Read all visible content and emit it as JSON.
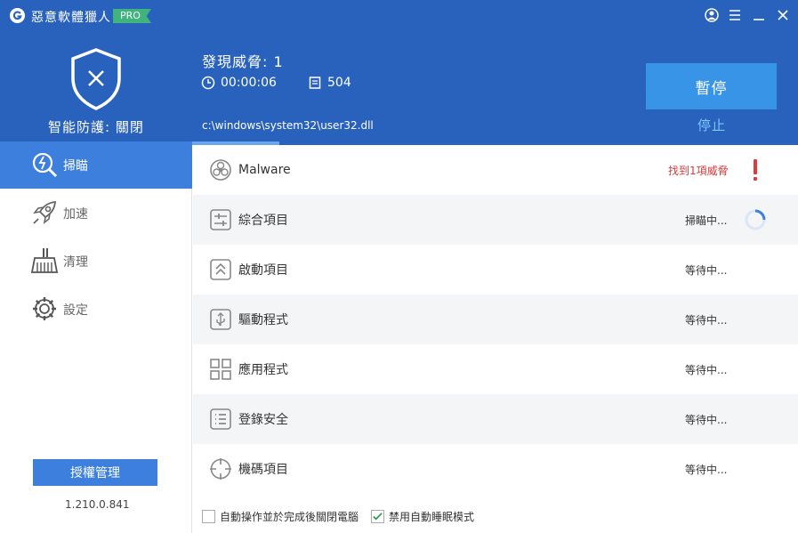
{
  "app": {
    "title": "惡意軟體獵人",
    "badge": "PRO"
  },
  "header": {
    "protect_label": "智能防護: 關閉",
    "threats_text": "發現威脅: 1",
    "elapsed": "00:00:06",
    "scanned_count": "504",
    "current_file": "c:\\windows\\system32\\user32.dll",
    "pause_label": "暫停",
    "stop_label": "停止",
    "progress_fraction": 0.35
  },
  "sidebar": {
    "items": [
      {
        "label": "掃瞄",
        "icon": "scan-icon",
        "active": true
      },
      {
        "label": "加速",
        "icon": "rocket-icon",
        "active": false
      },
      {
        "label": "清理",
        "icon": "broom-icon",
        "active": false
      },
      {
        "label": "設定",
        "icon": "gear-icon",
        "active": false
      }
    ],
    "license_label": "授權管理",
    "version": "1.210.0.841"
  },
  "scan_items": [
    {
      "label": "Malware",
      "status": "找到1項威脅",
      "icon": "biohazard-icon",
      "state": "alert"
    },
    {
      "label": "綜合項目",
      "status": "掃瞄中...",
      "icon": "sliders-icon",
      "state": "scanning"
    },
    {
      "label": "啟動項目",
      "status": "等待中...",
      "icon": "startup-icon",
      "state": "waiting"
    },
    {
      "label": "驅動程式",
      "status": "等待中...",
      "icon": "usb-driver-icon",
      "state": "waiting"
    },
    {
      "label": "應用程式",
      "status": "等待中...",
      "icon": "grid-apps-icon",
      "state": "waiting"
    },
    {
      "label": "登錄安全",
      "status": "等待中...",
      "icon": "registry-list-icon",
      "state": "waiting"
    },
    {
      "label": "機碼項目",
      "status": "等待中...",
      "icon": "crosshair-icon",
      "state": "waiting"
    }
  ],
  "footer": {
    "shutdown_label": "自動操作並於完成後關閉電腦",
    "shutdown_checked": false,
    "nosleep_label": "禁用自動睡眠模式",
    "nosleep_checked": true
  },
  "colors": {
    "header_bg": "#2962bd",
    "accent": "#3c7fdd",
    "button": "#3794e6",
    "alert": "#d63a3a",
    "pro": "#3fb47d"
  }
}
